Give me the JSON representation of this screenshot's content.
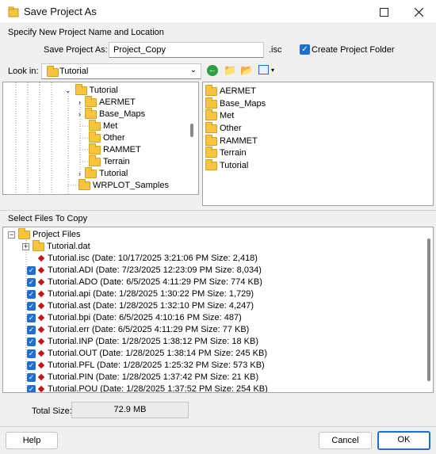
{
  "window": {
    "title": "Save Project As"
  },
  "specify": {
    "group_label": "Specify New Project Name and Location",
    "save_label": "Save Project As:",
    "save_value": "Project_Copy",
    "ext": ".isc",
    "create_folder_label": "Create Project Folder",
    "create_folder_checked": true
  },
  "lookin": {
    "label": "Look in:",
    "value": "Tutorial"
  },
  "tree": {
    "root": "Tutorial",
    "children": [
      "AERMET",
      "Base_Maps",
      "Met",
      "Other",
      "RAMMET",
      "Terrain",
      "Tutorial"
    ],
    "sibling": "WRPLOT_Samples"
  },
  "list": {
    "items": [
      "AERMET",
      "Base_Maps",
      "Met",
      "Other",
      "RAMMET",
      "Terrain",
      "Tutorial"
    ]
  },
  "files": {
    "group_label": "Select Files To Copy",
    "root": "Project Files",
    "subfolder": "Tutorial.dat",
    "rows": [
      {
        "text": "Tutorial.isc (Date: 10/17/2025 3:21:06 PM  Size: 2,418)",
        "checkbox": false
      },
      {
        "text": "Tutorial.ADI (Date: 7/23/2025 12:23:09 PM  Size: 8,034)",
        "checkbox": true
      },
      {
        "text": "Tutorial.ADO (Date: 6/5/2025 4:11:29 PM  Size: 774 KB)",
        "checkbox": true
      },
      {
        "text": "Tutorial.api (Date: 1/28/2025 1:30:22 PM  Size: 1,729)",
        "checkbox": true
      },
      {
        "text": "Tutorial.ast (Date: 1/28/2025 1:32:10 PM  Size: 4,247)",
        "checkbox": true
      },
      {
        "text": "Tutorial.bpi (Date: 6/5/2025 4:10:16 PM  Size: 487)",
        "checkbox": true
      },
      {
        "text": "Tutorial.err (Date: 6/5/2025 4:11:29 PM  Size: 77 KB)",
        "checkbox": true
      },
      {
        "text": "Tutorial.INP (Date: 1/28/2025 1:38:12 PM  Size: 18 KB)",
        "checkbox": true
      },
      {
        "text": "Tutorial.OUT (Date: 1/28/2025 1:38:14 PM  Size: 245 KB)",
        "checkbox": true
      },
      {
        "text": "Tutorial.PFL (Date: 1/28/2025 1:25:32 PM  Size: 573 KB)",
        "checkbox": true
      },
      {
        "text": "Tutorial.PIN (Date: 1/28/2025 1:37:42 PM  Size: 21 KB)",
        "checkbox": true
      },
      {
        "text": "Tutorial.POU (Date: 1/28/2025 1:37:52 PM  Size: 254 KB)",
        "checkbox": true
      }
    ]
  },
  "total": {
    "label": "Total Size:",
    "value": "72.9 MB"
  },
  "buttons": {
    "help": "Help",
    "cancel": "Cancel",
    "ok": "OK"
  },
  "colors": {
    "accent": "#1f6fd0",
    "folder": "#f5c53d",
    "file_marker": "#c81414"
  }
}
